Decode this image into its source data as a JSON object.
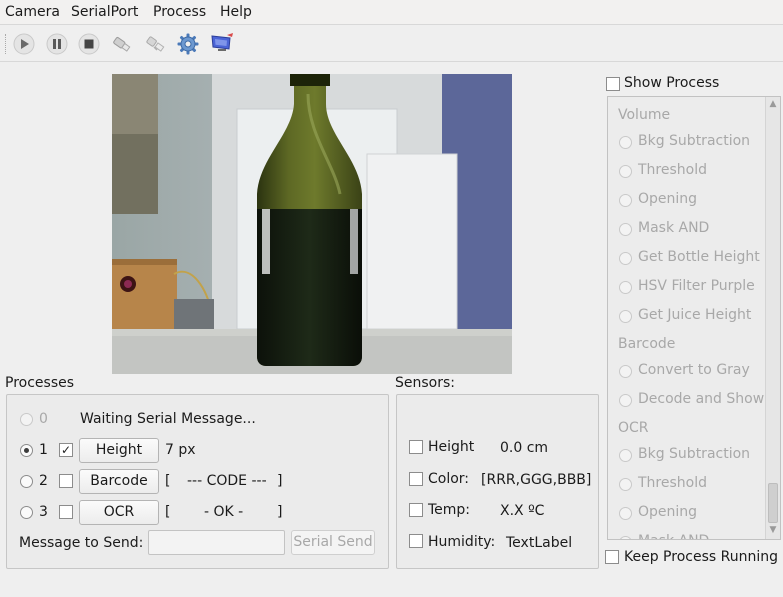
{
  "menu": {
    "items": [
      "Camera",
      "SerialPort",
      "Process",
      "Help"
    ]
  },
  "toolbar": {
    "buttons": [
      "play-icon",
      "pause-icon",
      "stop-icon",
      "connect-icon",
      "disconnect-icon",
      "settings-gear-icon",
      "display-icon"
    ]
  },
  "processes": {
    "title": "Processes",
    "rows": [
      {
        "number": "0",
        "status": "Waiting Serial Message..."
      },
      {
        "number": "1",
        "button": "Height",
        "value": "7 px"
      },
      {
        "number": "2",
        "button": "Barcode",
        "bracket_open": "[",
        "value": "--- CODE ---",
        "bracket_close": "]"
      },
      {
        "number": "3",
        "button": "OCR",
        "bracket_open": "[",
        "value": "- OK -",
        "bracket_close": "]"
      }
    ],
    "message_label": "Message to Send:",
    "message_value": "",
    "send_button": "Serial Send"
  },
  "sensors": {
    "title": "Sensors:",
    "rows": [
      {
        "label": "Height",
        "value": "0.0 cm"
      },
      {
        "label": "Color:",
        "value": "[RRR,GGG,BBB]"
      },
      {
        "label": "Temp:",
        "value": "X.X ºC"
      },
      {
        "label": "Humidity:",
        "value": "TextLabel"
      }
    ]
  },
  "show_process": {
    "label": "Show Process",
    "items": [
      {
        "type": "header",
        "label": "Volume"
      },
      {
        "type": "radio",
        "label": "Bkg Subtraction"
      },
      {
        "type": "radio",
        "label": "Threshold"
      },
      {
        "type": "radio",
        "label": "Opening"
      },
      {
        "type": "radio",
        "label": "Mask AND"
      },
      {
        "type": "radio",
        "label": "Get Bottle Height"
      },
      {
        "type": "radio",
        "label": "HSV Filter Purple"
      },
      {
        "type": "radio",
        "label": "Get Juice Height"
      },
      {
        "type": "header",
        "label": "Barcode"
      },
      {
        "type": "radio",
        "label": "Convert to Gray"
      },
      {
        "type": "radio",
        "label": "Decode and Show"
      },
      {
        "type": "header",
        "label": "OCR"
      },
      {
        "type": "radio",
        "label": "Bkg Subtraction"
      },
      {
        "type": "radio",
        "label": "Threshold"
      },
      {
        "type": "radio",
        "label": "Opening"
      },
      {
        "type": "radio",
        "label": "Mask AND"
      }
    ]
  },
  "keep_running": {
    "label": "Keep Process Running"
  }
}
